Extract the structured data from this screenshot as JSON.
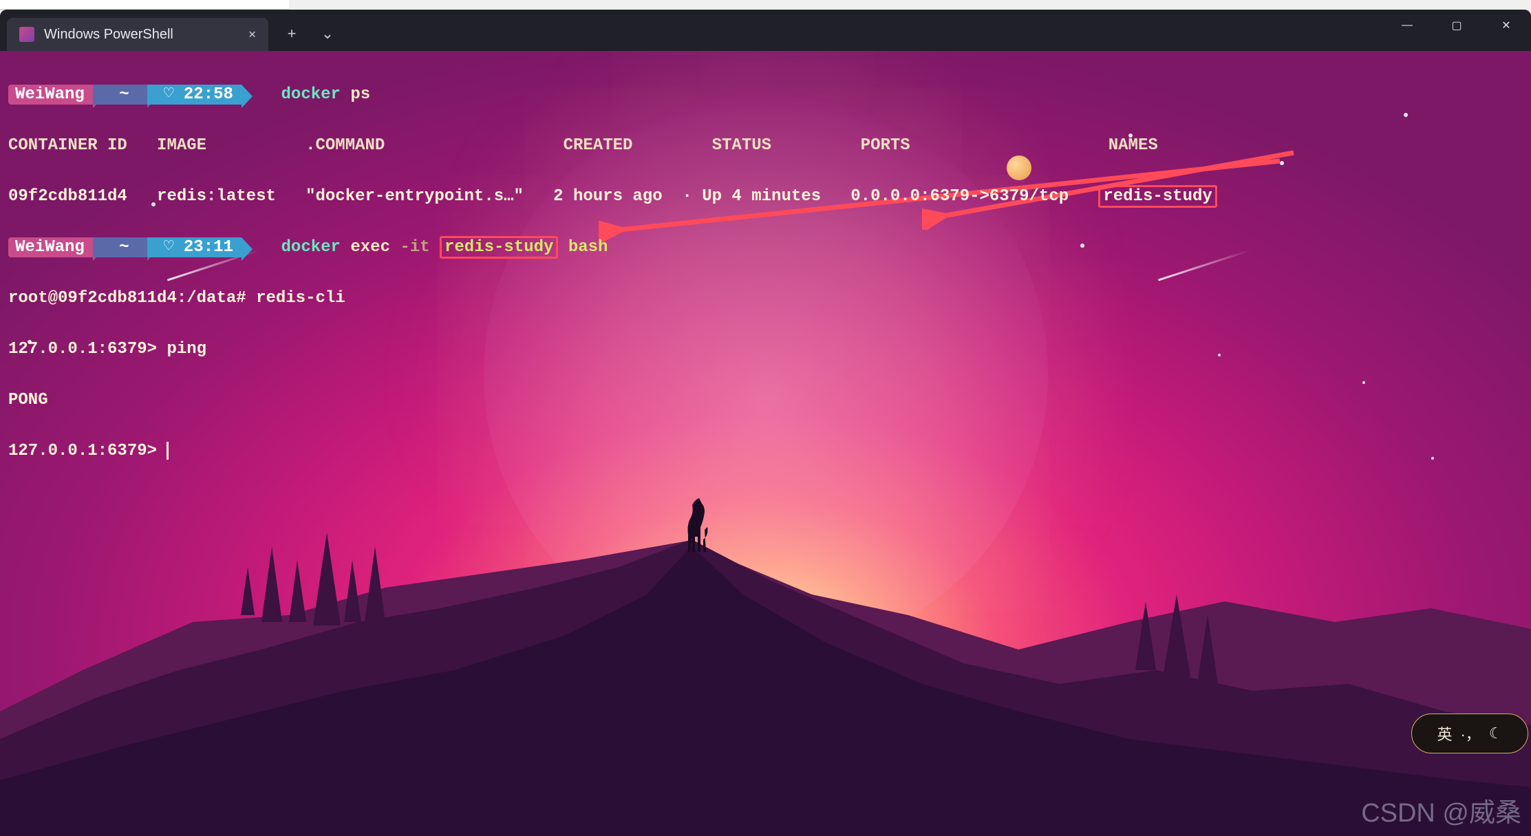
{
  "tab": {
    "title": "Windows PowerShell"
  },
  "window_controls": {
    "minimize": "—",
    "maximize": "▢",
    "close": "✕"
  },
  "prompt1": {
    "user": "WeiWang",
    "path": "~",
    "time_icon": "♡",
    "time": "22:58",
    "command": "docker",
    "subcommand": "ps"
  },
  "ps_header": {
    "container_id": "CONTAINER ID",
    "image": "IMAGE",
    "command": "COMMAND",
    "created": "CREATED",
    "status": "STATUS",
    "ports": "PORTS",
    "names": "NAMES"
  },
  "ps_row": {
    "container_id": "09f2cdb811d4",
    "image": "redis:latest",
    "command": "\"docker-entrypoint.s…\"",
    "created": "2 hours ago",
    "status": "Up 4 minutes",
    "ports": "0.0.0.0:6379->6379/tcp",
    "names": "redis-study"
  },
  "prompt2": {
    "user": "WeiWang",
    "path": "~",
    "time_icon": "♡",
    "time": "23:11",
    "command": "docker",
    "subcommand": "exec",
    "flag": "-it",
    "container": "redis-study",
    "shell": "bash"
  },
  "shell": {
    "root_prompt": "root@09f2cdb811d4:/data#",
    "redis_cli": "redis-cli",
    "redis_prompt": "127.0.0.1:6379>",
    "ping": "ping",
    "pong": "PONG"
  },
  "ime": {
    "label": "英",
    "sep": "，",
    "icon": "☾"
  },
  "watermark": "CSDN @威桑"
}
